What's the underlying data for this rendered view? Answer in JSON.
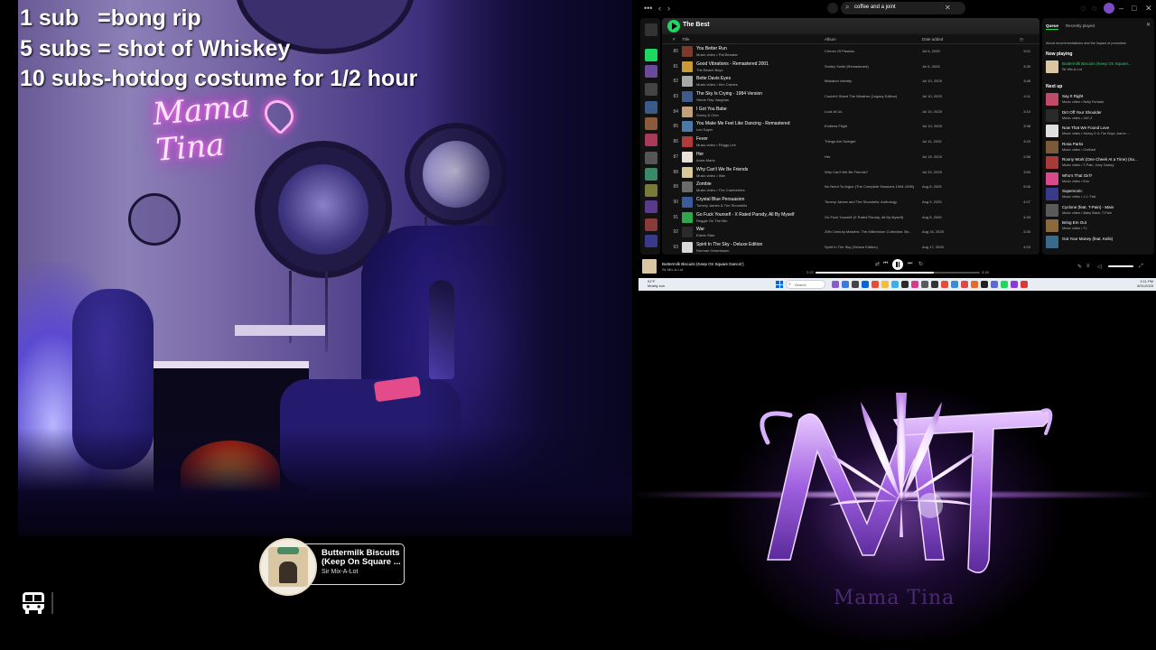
{
  "overlay": {
    "sub_goals": [
      "1 sub   =bong rip",
      "5 subs = shot of Whiskey",
      "10 subs-hotdog costume for 1/2 hour"
    ],
    "neon_sign": "Mama Tina"
  },
  "now_playing_widget": {
    "title_line1": "Buttermilk Biscuits",
    "title_line2": "(Keep On Square ...",
    "artist": "Sir Mix-A-Lot",
    "icon": "bus-icon"
  },
  "spotify": {
    "search_query": "coffee and a joint",
    "playlist_title": "The Best",
    "columns": {
      "num": "#",
      "title": "Title",
      "album": "Album",
      "date": "Date added",
      "duration_icon": "clock-icon"
    },
    "rows": [
      {
        "num": "80",
        "title": "You Better Run",
        "artist": "Music video • Pat Benatar",
        "album": "Crimes Of Passion",
        "date": "Jul 6, 2025",
        "duration": "3:01",
        "color": "#7a3b2b"
      },
      {
        "num": "81",
        "title": "Good Vibrations - Remastered 2001",
        "artist": "The Beach Boys",
        "album": "Smiley Smile (Remastered)",
        "date": "Jul 6, 2025",
        "duration": "3:39",
        "color": "#c89a3a"
      },
      {
        "num": "82",
        "title": "Bette Davis Eyes",
        "artist": "Music video • Kim Carnes",
        "album": "Mistaken Identity",
        "date": "Jul 10, 2025",
        "duration": "3:48",
        "color": "#a8a8a8"
      },
      {
        "num": "83",
        "title": "The Sky Is Crying - 1984 Version",
        "artist": "Stevie Ray Vaughan",
        "album": "Couldn't Stand The Weather (Legacy Edition)",
        "date": "Jul 10, 2025",
        "duration": "4:11",
        "color": "#3d5a8a"
      },
      {
        "num": "84",
        "title": "I Got You Babe",
        "artist": "Sonny & Cher",
        "album": "Look At Us",
        "date": "Jul 10, 2025",
        "duration": "3:10",
        "color": "#c2a07a"
      },
      {
        "num": "85",
        "title": "You Make Me Feel Like Dancing - Remastered",
        "artist": "Leo Sayer",
        "album": "Endless Flight",
        "date": "Jul 10, 2025",
        "duration": "3:38",
        "color": "#4d7aa8"
      },
      {
        "num": "86",
        "title": "Fever",
        "artist": "Music video • Peggy Lee",
        "album": "Things Are Swingin'",
        "date": "Jul 11, 2025",
        "duration": "3:20",
        "color": "#b03a3a"
      },
      {
        "num": "87",
        "title": "Her",
        "artist": "Anne-Marie",
        "album": "Her",
        "date": "Jul 15, 2025",
        "duration": "2:58",
        "color": "#e8e0d8"
      },
      {
        "num": "88",
        "title": "Why Can't We Be Friends",
        "artist": "Music video • War",
        "album": "Why Can't We Be Friends?",
        "date": "Jul 20, 2025",
        "duration": "3:50",
        "color": "#d8c89a"
      },
      {
        "num": "89",
        "title": "Zombie",
        "artist": "Music video • The Cranberries",
        "album": "No Need To Argue (The Complete Sessions 1994-1995)",
        "date": "Aug 8, 2025",
        "duration": "5:06",
        "color": "#6a6a6a"
      },
      {
        "num": "90",
        "title": "Crystal Blue Persuasion",
        "artist": "Tommy James & The Shondells",
        "album": "Tommy James and The Shondells: Anthology",
        "date": "Aug 9, 2025",
        "duration": "4:07",
        "color": "#3a5a9a"
      },
      {
        "num": "91",
        "title": "Go Fuck Yourself - X Rated Parody, All By Myself",
        "artist": "Reggie On The Mic",
        "album": "Go Fuck Yourself (X Rated Parody, All By Myself)",
        "date": "Aug 8, 2025",
        "duration": "4:49",
        "color": "#2ea84a"
      },
      {
        "num": "92",
        "title": "War",
        "artist": "Edwin Starr",
        "album": "20th Century Masters: The Millennium Collection: Be...",
        "date": "Aug 16, 2025",
        "duration": "3:30",
        "color": "#2a2a2a"
      },
      {
        "num": "93",
        "title": "Spirit In The Sky - Deluxe Edition",
        "artist": "Norman Greenbaum",
        "album": "Spirit In The Sky (Deluxe Edition)",
        "date": "Aug 17, 2025",
        "duration": "4:03",
        "color": "#d8d8d8"
      }
    ],
    "queue": {
      "tab_queue": "Queue",
      "tab_recent": "Recently played",
      "about": "About recommendations and the impact of promotion",
      "now_playing_label": "Now playing",
      "now_playing": {
        "title": "Buttermilk Biscuits (Keep On Square...",
        "sub": "Sir Mix-A-Lot",
        "color": "#d9c7a3"
      },
      "next_up_label": "Next up",
      "items": [
        {
          "title": "Say It Right",
          "sub": "Music video • Nelly Furtado",
          "color": "#c04a6a"
        },
        {
          "title": "Dirt Off Your Shoulder",
          "sub": "Music video • JAY-Z",
          "color": "#2a2a2a"
        },
        {
          "title": "Now That We Found Love",
          "sub": "Music video • Heavy D & The Boyz, Aaron ...",
          "color": "#e0e0e0"
        },
        {
          "title": "Rosa Parks",
          "sub": "Music video • OutKast",
          "color": "#7a5a3a"
        },
        {
          "title": "Roony Work (One Cheek At a Time) (Su...",
          "sub": "Music video • T-Pain, Joey Galaxy",
          "color": "#a83a3a"
        },
        {
          "title": "Who's That Girl?",
          "sub": "Music video • Eve",
          "color": "#d84a8a"
        },
        {
          "title": "Supersonic",
          "sub": "Music video • J.J. Fad",
          "color": "#3a3a8a"
        },
        {
          "title": "Cyclone (feat. T-Pain) - Main",
          "sub": "Music video • Baby Bash, T-Pain",
          "color": "#5a5a5a"
        },
        {
          "title": "Bring Em Out",
          "sub": "Music video • T.I.",
          "color": "#8a6a3a"
        },
        {
          "title": "Got Your Money (feat. Kelis)",
          "sub": "",
          "color": "#3a6a8a"
        }
      ]
    },
    "player": {
      "title": "Buttermilk Biscuits (Keep On Square Dancin')",
      "artist": "Sir Mix-A-Lot",
      "elapsed": "2:22",
      "total": "3:18",
      "progress": 0.72
    }
  },
  "taskbar": {
    "weather_temp": "91°F",
    "weather_desc": "Mostly sun",
    "search": "Search",
    "time": "3:11 PM",
    "date": "8/31/2025"
  },
  "logo": {
    "text": "Mama Tina"
  }
}
